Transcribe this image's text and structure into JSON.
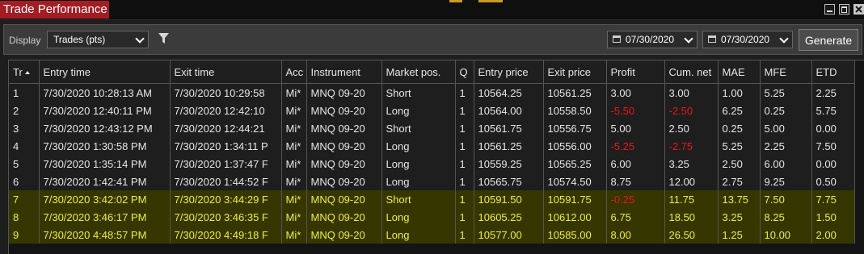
{
  "window": {
    "title": "Trade Performance"
  },
  "toolbar": {
    "display_label": "Display",
    "display_value": "Trades (pts)",
    "date_from": "07/30/2020",
    "date_to": "07/30/2020",
    "generate_label": "Generate"
  },
  "grid": {
    "columns": [
      "Tr",
      "Entry time",
      "Exit time",
      "Acc",
      "Instrument",
      "Market pos.",
      "Q",
      "Entry price",
      "Exit price",
      "Profit",
      "Cum. net",
      "MAE",
      "MFE",
      "ETD"
    ],
    "rows": [
      [
        "1",
        "7/30/2020 10:28:13 AM",
        "7/30/2020 10:29:58",
        "Mi*",
        "MNQ 09-20",
        "Short",
        "1",
        "10564.25",
        "10561.25",
        "3.00",
        "3.00",
        "1.00",
        "5.25",
        "2.25"
      ],
      [
        "2",
        "7/30/2020 12:40:11 PM",
        "7/30/2020 12:42:10",
        "Mi*",
        "MNQ 09-20",
        "Long",
        "1",
        "10564.00",
        "10558.50",
        "-5.50",
        "-2.50",
        "6.25",
        "0.25",
        "5.75"
      ],
      [
        "3",
        "7/30/2020 12:43:12 PM",
        "7/30/2020 12:44:21",
        "Mi*",
        "MNQ 09-20",
        "Short",
        "1",
        "10561.75",
        "10556.75",
        "5.00",
        "2.50",
        "0.25",
        "5.00",
        "0.00"
      ],
      [
        "4",
        "7/30/2020 1:30:58 PM",
        "7/30/2020 1:34:11 P",
        "Mi*",
        "MNQ 09-20",
        "Long",
        "1",
        "10561.25",
        "10556.00",
        "-5.25",
        "-2.75",
        "5.25",
        "2.25",
        "7.50"
      ],
      [
        "5",
        "7/30/2020 1:35:14 PM",
        "7/30/2020 1:37:47 F",
        "Mi*",
        "MNQ 09-20",
        "Long",
        "1",
        "10559.25",
        "10565.25",
        "6.00",
        "3.25",
        "2.50",
        "6.00",
        "0.00"
      ],
      [
        "6",
        "7/30/2020 1:42:41 PM",
        "7/30/2020 1:44:52 F",
        "Mi*",
        "MNQ 09-20",
        "Long",
        "1",
        "10565.75",
        "10574.50",
        "8.75",
        "12.00",
        "2.75",
        "9.25",
        "0.50"
      ],
      [
        "7",
        "7/30/2020 3:42:02 PM",
        "7/30/2020 3:44:29 F",
        "Mi*",
        "MNQ 09-20",
        "Short",
        "1",
        "10591.50",
        "10591.75",
        "-0.25",
        "11.75",
        "13.75",
        "7.50",
        "7.75"
      ],
      [
        "8",
        "7/30/2020 3:46:17 PM",
        "7/30/2020 3:46:35 F",
        "Mi*",
        "MNQ 09-20",
        "Long",
        "1",
        "10605.25",
        "10612.00",
        "6.75",
        "18.50",
        "3.25",
        "8.25",
        "1.50"
      ],
      [
        "9",
        "7/30/2020 4:48:57 PM",
        "7/30/2020 4:49:18 F",
        "Mi*",
        "MNQ 09-20",
        "Long",
        "1",
        "10577.00",
        "10585.00",
        "8.00",
        "26.50",
        "1.25",
        "10.00",
        "2.00"
      ]
    ],
    "highlighted_rows": [
      7,
      8,
      9
    ]
  },
  "colors": {
    "title_tab": "#a41d24",
    "negative": "#e8171c",
    "highlight_text": "#eded45",
    "highlight_bg": "#363600"
  },
  "icons": [
    "filter-icon",
    "calendar-icon",
    "chevron-down-icon",
    "minimize-icon",
    "maximize-icon",
    "close-icon",
    "sort-ascending-icon"
  ]
}
